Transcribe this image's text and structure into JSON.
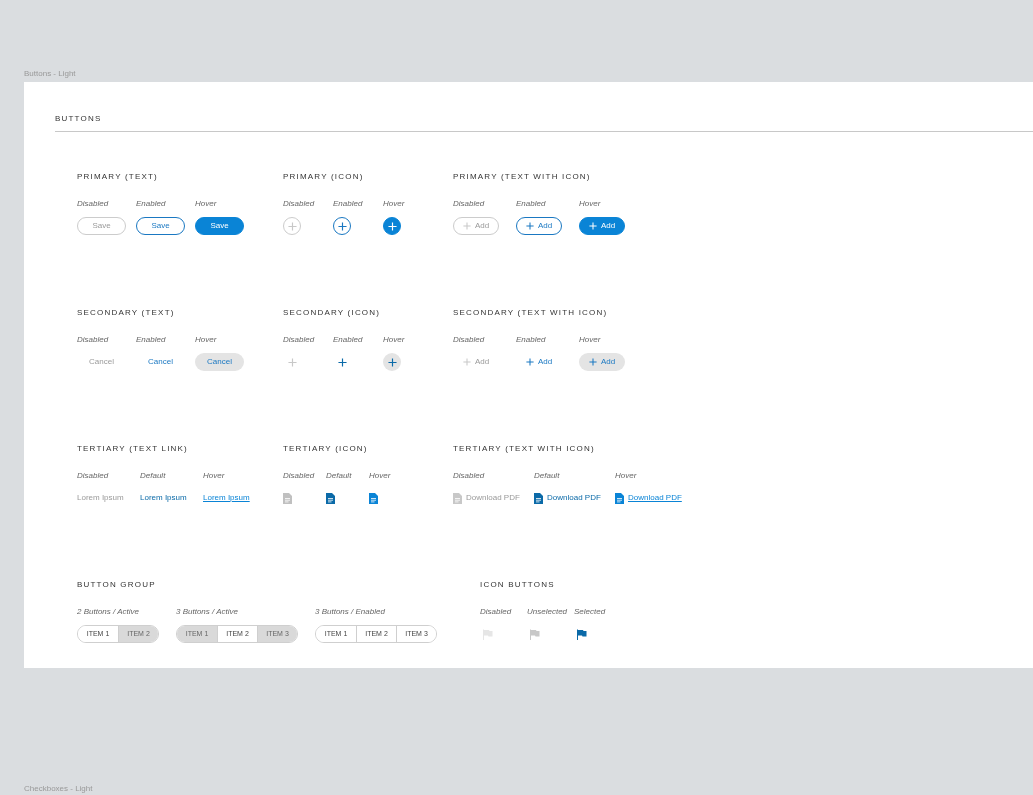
{
  "canvas_label": "Buttons - Light",
  "heading": "BUTTONS",
  "rows": [
    [
      {
        "title": "PRIMARY (TEXT)",
        "kind": "primary_text",
        "variants": [
          {
            "label": "Disabled",
            "disabled": true,
            "hovered": false,
            "text": "Save"
          },
          {
            "label": "Enabled",
            "disabled": false,
            "hovered": false,
            "text": "Save"
          },
          {
            "label": "Hover",
            "disabled": false,
            "hovered": true,
            "text": "Save"
          }
        ]
      },
      {
        "title": "PRIMARY (ICON)",
        "kind": "primary_icon",
        "variants": [
          {
            "label": "Disabled",
            "disabled": true,
            "hovered": false
          },
          {
            "label": "Enabled",
            "disabled": false,
            "hovered": false
          },
          {
            "label": "Hover",
            "disabled": false,
            "hovered": true
          }
        ]
      },
      {
        "title": "PRIMARY (TEXT WITH ICON)",
        "kind": "primary_text_icon",
        "variants": [
          {
            "label": "Disabled",
            "disabled": true,
            "hovered": false,
            "text": "Add"
          },
          {
            "label": "Enabled",
            "disabled": false,
            "hovered": false,
            "text": "Add"
          },
          {
            "label": "Hover",
            "disabled": false,
            "hovered": true,
            "text": "Add"
          }
        ]
      }
    ],
    [
      {
        "title": "SECONDARY (TEXT)",
        "kind": "secondary_text",
        "variants": [
          {
            "label": "Disabled",
            "disabled": true,
            "hovered": false,
            "text": "Cancel"
          },
          {
            "label": "Enabled",
            "disabled": false,
            "hovered": false,
            "text": "Cancel"
          },
          {
            "label": "Hover",
            "disabled": false,
            "hovered": true,
            "text": "Cancel"
          }
        ]
      },
      {
        "title": "SECONDARY (ICON)",
        "kind": "secondary_icon",
        "variants": [
          {
            "label": "Disabled",
            "disabled": true,
            "hovered": false
          },
          {
            "label": "Enabled",
            "disabled": false,
            "hovered": false
          },
          {
            "label": "Hover",
            "disabled": false,
            "hovered": true
          }
        ]
      },
      {
        "title": "SECONDARY (TEXT WITH ICON)",
        "kind": "secondary_text_icon",
        "variants": [
          {
            "label": "Disabled",
            "disabled": true,
            "hovered": false,
            "text": "Add"
          },
          {
            "label": "Enabled",
            "disabled": false,
            "hovered": false,
            "text": "Add"
          },
          {
            "label": "Hover",
            "disabled": false,
            "hovered": true,
            "text": "Add"
          }
        ]
      }
    ],
    [
      {
        "title": "TERTIARY (TEXT LINK)",
        "kind": "tertiary_link",
        "variants": [
          {
            "label": "Disabled",
            "disabled": true,
            "hovered": false,
            "text": "Lorem Ipsum"
          },
          {
            "label": "Default",
            "disabled": false,
            "hovered": false,
            "text": "Lorem Ipsum"
          },
          {
            "label": "Hover",
            "disabled": false,
            "hovered": true,
            "text": "Lorem Ipsum"
          }
        ]
      },
      {
        "title": "TERTIARY (ICON)",
        "kind": "tertiary_icon",
        "variants": [
          {
            "label": "Disabled",
            "disabled": true,
            "hovered": false
          },
          {
            "label": "Default",
            "disabled": false,
            "hovered": false
          },
          {
            "label": "Hover",
            "disabled": false,
            "hovered": true
          }
        ]
      },
      {
        "title": "TERTIARY (TEXT WITH ICON)",
        "kind": "tertiary_text_icon",
        "variants": [
          {
            "label": "Disabled",
            "disabled": true,
            "hovered": false,
            "text": "Download PDF"
          },
          {
            "label": "Default",
            "disabled": false,
            "hovered": false,
            "text": "Download PDF"
          },
          {
            "label": "Hover",
            "disabled": false,
            "hovered": true,
            "text": "Download PDF"
          }
        ]
      }
    ],
    [
      {
        "title": "BUTTON GROUP",
        "kind": "button_group",
        "variants": [
          {
            "label": "2 Buttons / Active",
            "items": [
              {
                "text": "ITEM 1",
                "dimmed": false
              },
              {
                "text": "ITEM 2",
                "dimmed": true
              }
            ]
          },
          {
            "label": "3 Buttons / Active",
            "items": [
              {
                "text": "ITEM 1",
                "dimmed": true
              },
              {
                "text": "ITEM 2",
                "dimmed": false
              },
              {
                "text": "ITEM 3",
                "dimmed": true
              }
            ]
          },
          {
            "label": "3 Buttons / Enabled",
            "items": [
              {
                "text": "ITEM 1",
                "dimmed": false
              },
              {
                "text": "ITEM 2",
                "dimmed": false
              },
              {
                "text": "ITEM 3",
                "dimmed": false
              }
            ]
          }
        ]
      },
      {
        "title": "ICON BUTTONS",
        "kind": "icon_button",
        "variants": [
          {
            "label": "Disabled",
            "disabled": true,
            "selected": false
          },
          {
            "label": "Unselected",
            "disabled": false,
            "selected": false
          },
          {
            "label": "Selected",
            "disabled": false,
            "selected": true
          }
        ]
      }
    ]
  ],
  "next_label": "Checkboxes - Light"
}
